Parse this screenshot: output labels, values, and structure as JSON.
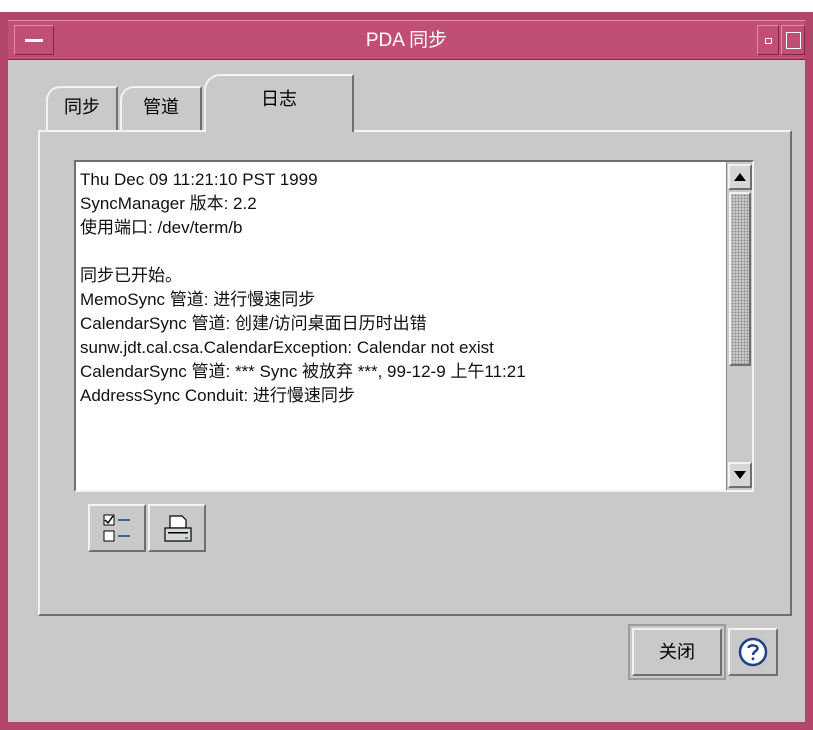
{
  "window": {
    "title": "PDA 同步"
  },
  "tabs": [
    {
      "label": "同步",
      "selected": false
    },
    {
      "label": "管道",
      "selected": false
    },
    {
      "label": "日志",
      "selected": true
    }
  ],
  "log": {
    "lines": [
      "Thu Dec 09 11:21:10 PST 1999",
      "SyncManager 版本: 2.2",
      "使用端口: /dev/term/b",
      "",
      "同步已开始。",
      "MemoSync 管道: 进行慢速同步",
      "CalendarSync 管道: 创建/访问桌面日历时出错",
      "sunw.jdt.cal.csa.CalendarException: Calendar not exist",
      "CalendarSync 管道: *** Sync 被放弃 ***, 99-12-9 上午11:21",
      "AddressSync Conduit: 进行慢速同步"
    ]
  },
  "buttons": {
    "close_label": "关闭"
  },
  "icons": {
    "menu": "window-menu-icon",
    "minimize": "minimize-icon",
    "maximize": "maximize-icon",
    "select": "checklist-icon",
    "print": "printer-icon",
    "help": "help-icon"
  },
  "colors": {
    "titlebar": "#c14e74",
    "frame": "#b1466a",
    "panel": "#c9c9c9"
  }
}
